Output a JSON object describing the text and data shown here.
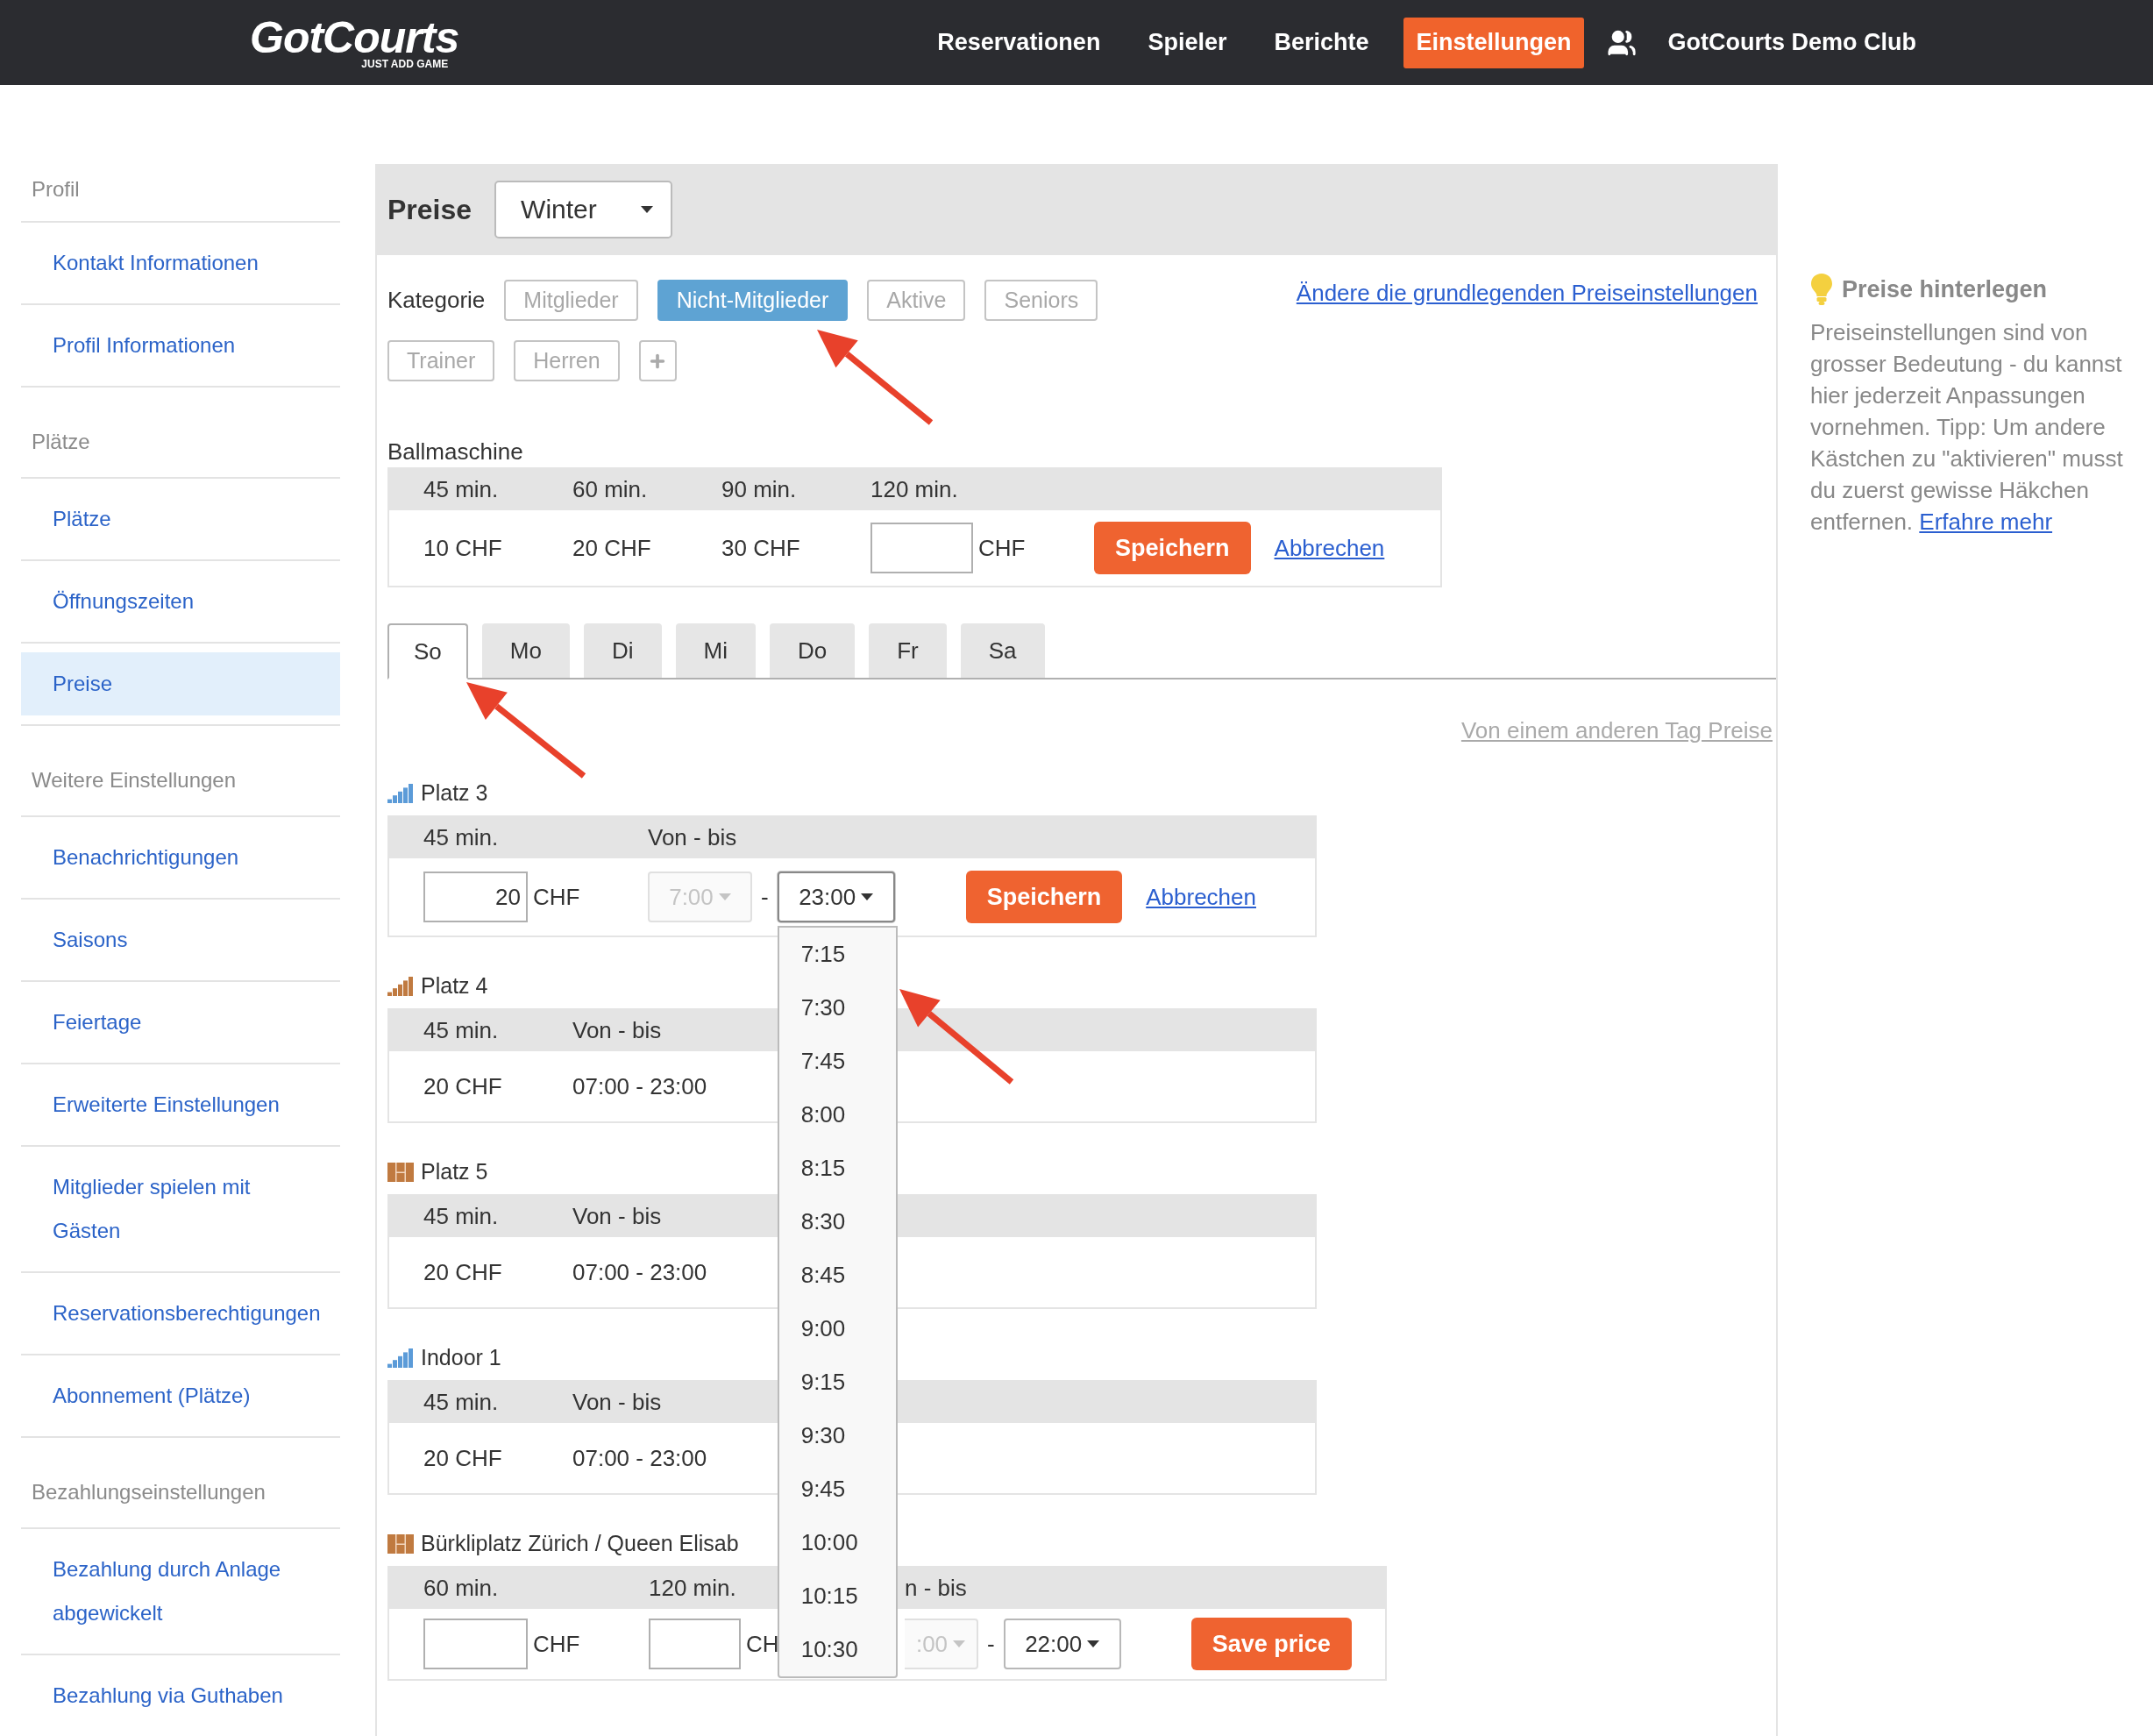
{
  "header": {
    "logo": "GotCourts",
    "tagline": "JUST ADD GAME",
    "nav": [
      {
        "label": "Reservationen",
        "selected": false
      },
      {
        "label": "Spieler",
        "selected": false
      },
      {
        "label": "Berichte",
        "selected": false
      },
      {
        "label": "Einstellungen",
        "selected": true
      }
    ],
    "club": "GotCourts Demo Club"
  },
  "sidebar": {
    "sections": [
      {
        "title": "Profil",
        "items": [
          {
            "label": "Kontakt Informationen",
            "selected": false
          },
          {
            "label": "Profil Informationen",
            "selected": false
          }
        ]
      },
      {
        "title": "Plätze",
        "items": [
          {
            "label": "Plätze",
            "selected": false
          },
          {
            "label": "Öffnungszeiten",
            "selected": false
          },
          {
            "label": "Preise",
            "selected": true
          }
        ]
      },
      {
        "title": "Weitere Einstellungen",
        "items": [
          {
            "label": "Benachrichtigungen",
            "selected": false
          },
          {
            "label": "Saisons",
            "selected": false
          },
          {
            "label": "Feiertage",
            "selected": false
          },
          {
            "label": "Erweiterte Einstellungen",
            "selected": false
          },
          {
            "label": "Mitglieder spielen mit Gästen",
            "selected": false
          },
          {
            "label": "Reservationsberechtigungen",
            "selected": false
          },
          {
            "label": "Abonnement (Plätze)",
            "selected": false
          }
        ]
      },
      {
        "title": "Bezahlungseinstellungen",
        "items": [
          {
            "label": "Bezahlung durch Anlage abgewickelt",
            "selected": false
          },
          {
            "label": "Bezahlung via Guthaben",
            "selected": false
          }
        ]
      }
    ]
  },
  "prices": {
    "title": "Preise",
    "season": "Winter",
    "category_label": "Kategorie",
    "categories": [
      {
        "label": "Mitglieder",
        "selected": false
      },
      {
        "label": "Nicht-Mitglieder",
        "selected": true
      },
      {
        "label": "Aktive",
        "selected": false
      },
      {
        "label": "Seniors",
        "selected": false
      },
      {
        "label": "Trainer",
        "selected": false
      },
      {
        "label": "Herren",
        "selected": false
      }
    ],
    "settings_link": "Ändere die grundlegenden Preiseinstellungen",
    "ball_machine": {
      "title": "Ballmaschine",
      "columns": [
        "45 min.",
        "60 min.",
        "90 min.",
        "120 min."
      ],
      "values": [
        "10 CHF",
        "20 CHF",
        "30 CHF"
      ],
      "currency": "CHF",
      "save": "Speichern",
      "cancel": "Abbrechen"
    },
    "days": [
      {
        "label": "So",
        "selected": true
      },
      {
        "label": "Mo",
        "selected": false
      },
      {
        "label": "Di",
        "selected": false
      },
      {
        "label": "Mi",
        "selected": false
      },
      {
        "label": "Do",
        "selected": false
      },
      {
        "label": "Fr",
        "selected": false
      },
      {
        "label": "Sa",
        "selected": false
      }
    ],
    "copy_link": "Von einem anderen Tag Preise",
    "courts": [
      {
        "kind": "edit",
        "name": "Platz 3",
        "color": "#5b9bd8",
        "columns": [
          "45 min.",
          "Von - bis"
        ],
        "prices": [
          {
            "value": "20",
            "currency": "CHF"
          }
        ],
        "from": {
          "value": "7:00",
          "disabled": true
        },
        "separator": "-",
        "to": {
          "value": "23:00",
          "disabled": false,
          "expanded": true,
          "options": [
            "7:15",
            "7:30",
            "7:45",
            "8:00",
            "8:15",
            "8:30",
            "8:45",
            "9:00",
            "9:15",
            "9:30",
            "9:45",
            "10:00",
            "10:15",
            "10:30"
          ]
        },
        "save": "Speichern",
        "cancel": "Abbrechen"
      },
      {
        "kind": "view",
        "name": "Platz 4",
        "color": "#c07a40",
        "columns": [
          "45 min.",
          "Von - bis"
        ],
        "values": [
          "20 CHF",
          "07:00 - 23:00"
        ]
      },
      {
        "kind": "view",
        "name": "Platz 5",
        "color": "#c07a40",
        "columns": [
          "45 min.",
          "Von - bis"
        ],
        "values": [
          "20 CHF",
          "07:00 - 23:00"
        ]
      },
      {
        "kind": "view",
        "name": "Indoor 1",
        "color": "#5b9bd8",
        "columns": [
          "45 min.",
          "Von - bis"
        ],
        "values": [
          "20 CHF",
          "07:00 - 23:00"
        ]
      },
      {
        "kind": "new",
        "name": "Bürkliplatz Zürich / Queen Elisab",
        "color": "#c07a40",
        "columns": [
          "60 min.",
          "120 min.",
          "n - bis"
        ],
        "prices": [
          {
            "currency": "CHF"
          },
          {
            "currency": "CH"
          }
        ],
        "from": {
          "value": ":00",
          "disabled": true
        },
        "separator": "-",
        "to": {
          "value": "22:00",
          "disabled": false
        },
        "save": "Save price"
      }
    ]
  },
  "tip": {
    "title": "Preise hinterlegen",
    "text": "Preiseinstellungen sind von grosser Bedeutung - du kannst hier jederzeit Anpassungen vornehmen. Tipp: Um andere Kästchen zu \"aktivieren\" musst du zuerst gewisse Häkchen entfernen.",
    "link": "Erfahre mehr"
  }
}
